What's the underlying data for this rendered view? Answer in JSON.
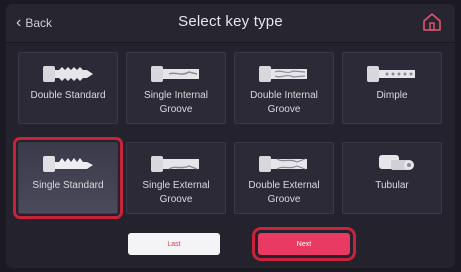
{
  "header": {
    "back_label": "Back",
    "title": "Select key type",
    "home_icon": "home-icon"
  },
  "key_types": [
    {
      "label": "Double Standard",
      "icon": "double-standard-key-icon",
      "selected": false
    },
    {
      "label": "Single Internal Groove",
      "icon": "single-internal-groove-key-icon",
      "selected": false
    },
    {
      "label": "Double Internal Groove",
      "icon": "double-internal-groove-key-icon",
      "selected": false
    },
    {
      "label": "Dimple",
      "icon": "dimple-key-icon",
      "selected": false
    },
    {
      "label": "Single Standard",
      "icon": "single-standard-key-icon",
      "selected": true
    },
    {
      "label": "Single External Groove",
      "icon": "single-external-groove-key-icon",
      "selected": false
    },
    {
      "label": "Double External Groove",
      "icon": "double-external-groove-key-icon",
      "selected": false
    },
    {
      "label": "Tubular",
      "icon": "tubular-key-icon",
      "selected": false
    }
  ],
  "footer": {
    "last_label": "Last",
    "next_label": "Next"
  },
  "colors": {
    "accent": "#e93a63",
    "highlight": "#c8233a",
    "background": "#23222d"
  }
}
